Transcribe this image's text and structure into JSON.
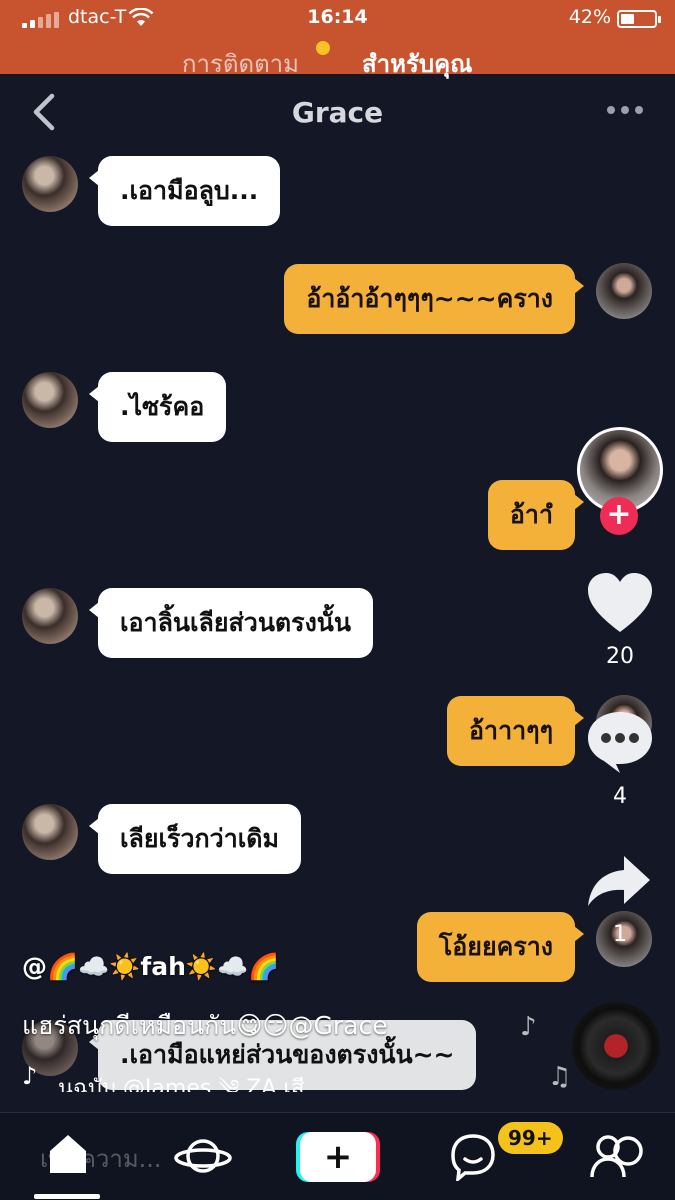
{
  "status_bar": {
    "carrier": "dtac-T",
    "time": "16:14",
    "battery": "42%",
    "battery_level": 0.42
  },
  "feed_tabs": {
    "following": "การติดตาม",
    "for_you": "สำหรับคุณ",
    "active": "for_you"
  },
  "chat": {
    "title": "Grace",
    "messages": [
      {
        "side": "in",
        "text": ".เอามือลูบ..."
      },
      {
        "side": "out",
        "text": "อ้าอ้าอ้าๆๆๆ~~~คราง"
      },
      {
        "side": "in",
        "text": ".ไซร้คอ"
      },
      {
        "side": "out",
        "text": "อ้าาํ"
      },
      {
        "side": "in",
        "text": "เอาลิ้นเลียส่วนตรงนั้น"
      },
      {
        "side": "out",
        "text": "อ้าาาๆๆ"
      },
      {
        "side": "in",
        "text": "เลียเร็วกว่าเดิม"
      },
      {
        "side": "out",
        "text": "โอ้ยยคราง"
      },
      {
        "side": "in",
        "text": ".เอามือแหย่ส่วนของตรงนั้น~~"
      }
    ]
  },
  "actions": {
    "likes": "20",
    "comments": "4",
    "shares": "1"
  },
  "caption": {
    "username": "@🌈☁️☀️fah☀️☁️🌈",
    "text": "แฮร่สนุกดีเหมือนกัน😋😏@Grace",
    "music": "นฉบับ    @James ༄ ZA เสี"
  },
  "bottom_nav": {
    "comment_placeholder": "เพิ่มความ...",
    "create": "+",
    "inbox_badge": "99+"
  },
  "colors": {
    "accent_orange": "#c8532f",
    "bubble_out": "#f4b139",
    "bubble_in": "#ffffff",
    "follow_red": "#ee2c55",
    "badge_yellow": "#f5c21b"
  }
}
